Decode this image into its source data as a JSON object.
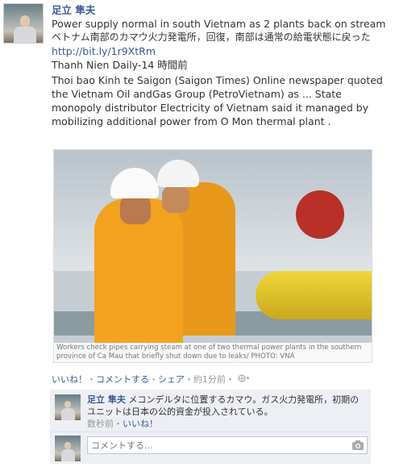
{
  "post": {
    "author": "足立 隼夫",
    "line1": "Power supply normal in south Vietnam as 2 plants back on stream",
    "line2": "ベトナム南部のカマウ火力発電所，回復，南部は通常の給電状態に戻った",
    "link": "http://bit.ly/1r9XtRm",
    "source": "Thanh Nien Daily-14 時間前",
    "snippet": "Thoi bao Kinh te Saigon (Saigon Times) Online newspaper quoted the Vietnam Oil andGas Group (PetroVietnam) as ... State monopoly distributor Electricity of Vietnam said it managed by mobilizing additional power from O Mon thermal plant ."
  },
  "photo": {
    "caption": "Workers check pipes carrying steam at one of two thermal power plants in the southern province of Ca Mau that briefly shut down due to leaks/ PHOTO: VNA"
  },
  "actions": {
    "like": "いいね！",
    "sep1": "・",
    "comment": "コメントする",
    "sep2": "・",
    "share": "シェア",
    "sep3": "・",
    "time": "約1分前",
    "sep4": "・"
  },
  "comment": {
    "author": "足立 隼夫",
    "text": "メコンデルタに位置するカマウ。ガス火力発電所，初期のユニットは日本の公的資金が投入されている。",
    "time": "数秒前",
    "sep": "・",
    "like": "いいね！"
  },
  "input": {
    "placeholder": "コメントする..."
  },
  "icons": {
    "globe": "globe-icon",
    "camera": "camera-icon"
  }
}
